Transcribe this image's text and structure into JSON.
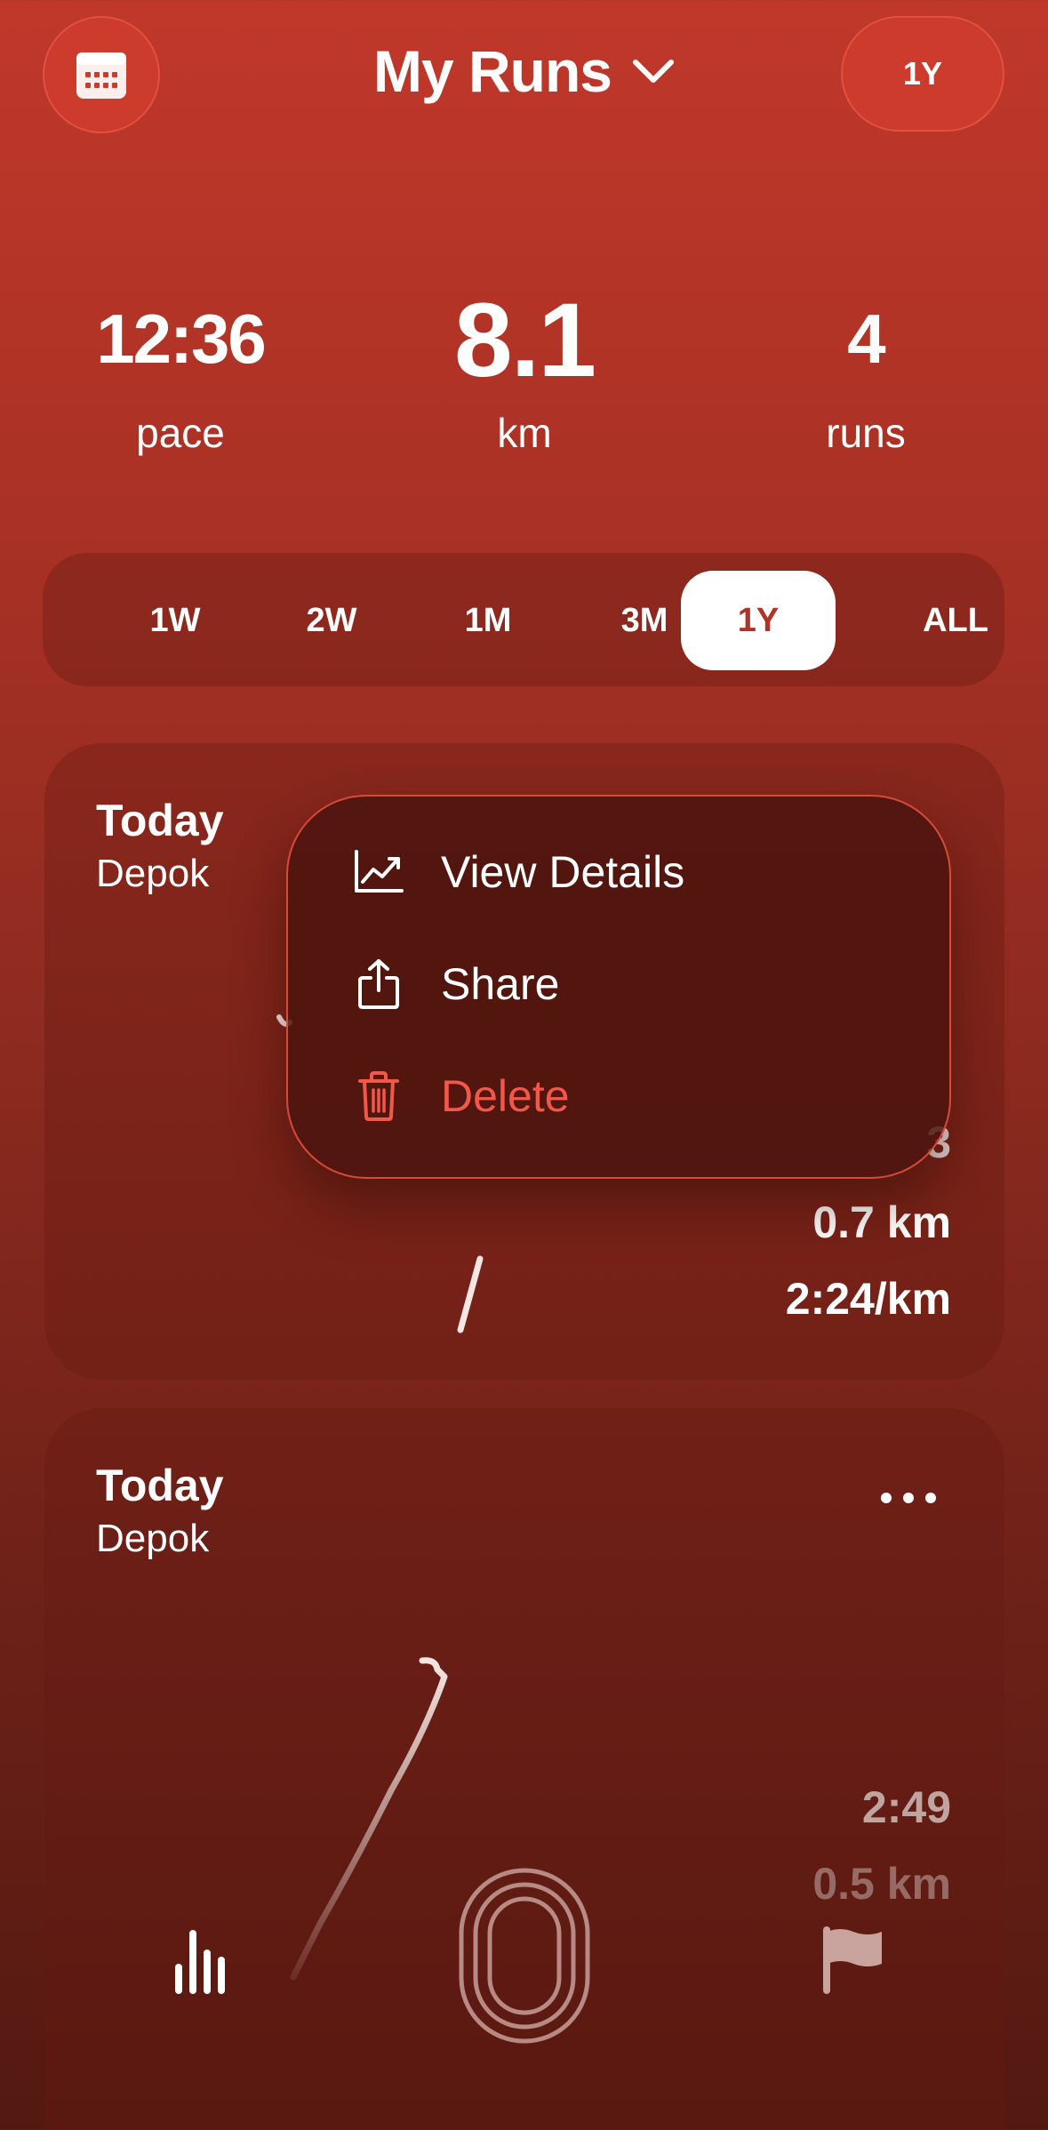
{
  "header": {
    "calendar_icon": "calendar-icon",
    "title": "My Runs",
    "title_chevron_icon": "chevron-down-icon",
    "period_button": "1Y"
  },
  "stats": [
    {
      "value": "12:36",
      "label": "pace"
    },
    {
      "value": "8.1",
      "label": "km"
    },
    {
      "value": "4",
      "label": "runs"
    }
  ],
  "period_tabs": {
    "items": [
      "1W",
      "2W",
      "1M",
      "3M",
      "1Y",
      "ALL"
    ],
    "selected": "1Y"
  },
  "runs": [
    {
      "day": "Today",
      "location": "Depok",
      "metrics": [
        "3",
        "0.7 km",
        "2:24/km"
      ]
    },
    {
      "day": "Today",
      "location": "Depok",
      "more_icon": "more-horizontal-icon",
      "metrics": [
        "2:49",
        "0.5 km"
      ]
    }
  ],
  "context_menu": {
    "items": [
      {
        "label": "View Details",
        "icon": "chart-line-icon"
      },
      {
        "label": "Share",
        "icon": "share-icon"
      },
      {
        "label": "Delete",
        "icon": "trash-icon",
        "destructive": true
      }
    ]
  },
  "tab_bar": {
    "items": [
      "stats-icon",
      "track-icon",
      "flag-icon"
    ]
  },
  "colors": {
    "accent": "#c0382a",
    "destructive": "#f2584a",
    "active_tab_bg": "#ffffff",
    "active_tab_text": "#b23326"
  }
}
